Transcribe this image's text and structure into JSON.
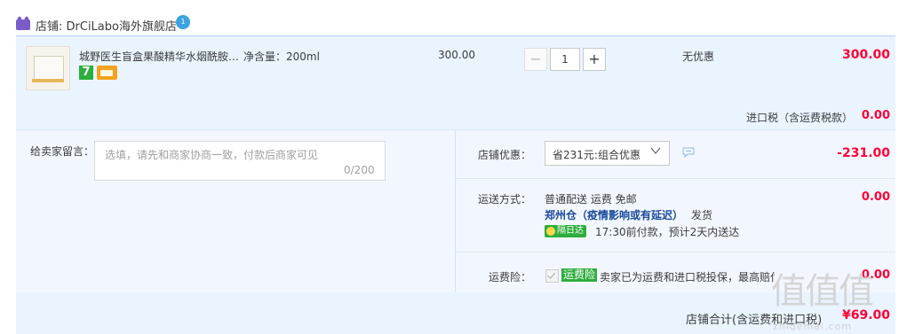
{
  "shop": {
    "name": "店铺: DrCiLabo海外旗舰店",
    "badge": "1"
  },
  "item": {
    "title": "城野医生盲盒果酸精华水烟酰胺…",
    "spec": "净含量：200ml",
    "price": "300.00",
    "quantity": "1",
    "promo": "无优惠",
    "subtotal": "300.00",
    "badge_number": "7"
  },
  "tax": {
    "label": "进口税（含运费税款）",
    "value": "0.00"
  },
  "message": {
    "label": "给卖家留言：",
    "placeholder": "选填，请先和商家协商一致，付款后商家可见",
    "counter": "0/200"
  },
  "discount": {
    "label": "店铺优惠：",
    "selected": "省231元:组合优惠",
    "value": "-231.00"
  },
  "shipping": {
    "label": "运送方式：",
    "method": "普通配送 运费 免邮",
    "warehouse": "郑州仓（疫情影响或有延迟）",
    "dispatch": "发货",
    "badge": "隔日达",
    "eta": "17:30前付款，预计2天内送达",
    "value": "0.00"
  },
  "insurance": {
    "label": "运费险：",
    "tag": "运费险",
    "text": "卖家已为运费和进口税投保，最高赔付30元",
    "value": "0.00"
  },
  "total": {
    "label": "店铺合计(含运费和进口税)",
    "value": "¥69.00"
  },
  "watermark": {
    "main": "值值值",
    "sub": "zhidemai.com"
  },
  "colors": {
    "accent_red": "#ff0036",
    "panel_bg": "#eaf4ff",
    "tag_green": "#2fae3d"
  }
}
